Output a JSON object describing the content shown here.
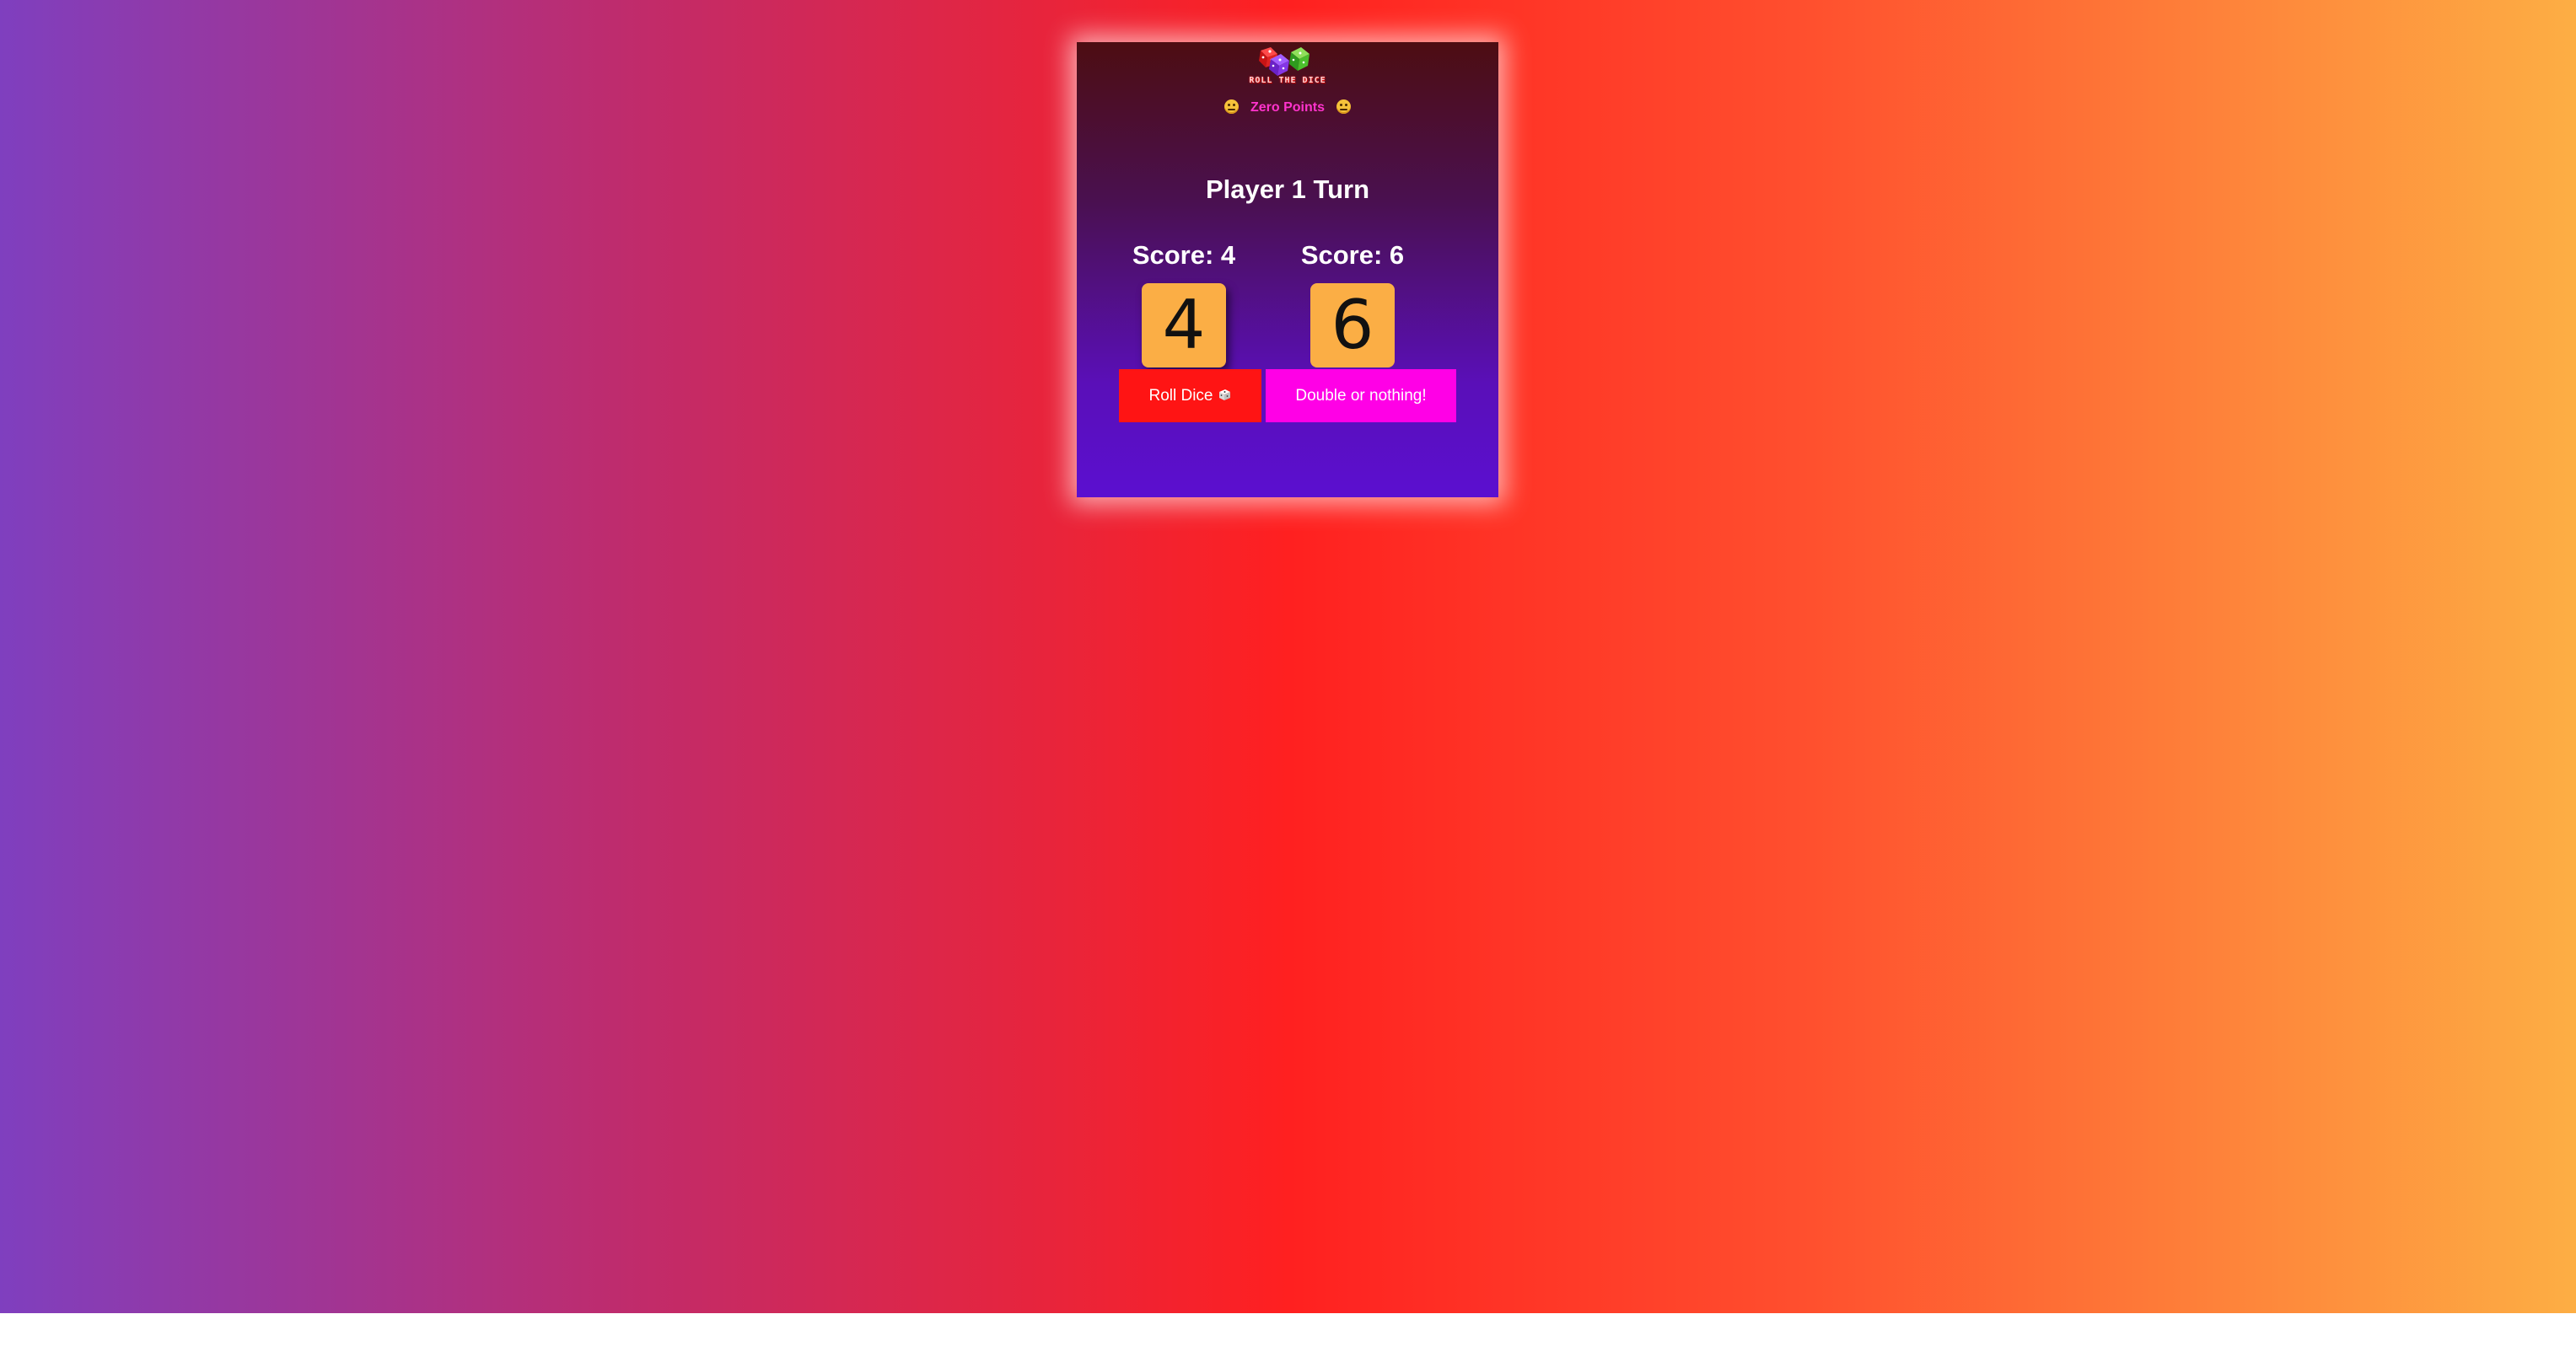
{
  "app": {
    "logo_text": "ROLL THE DICE",
    "status": {
      "text": "Zero Points",
      "left_icon": "unhappy-face-icon",
      "right_icon": "unhappy-face-icon"
    },
    "turn_title": "Player 1 Turn",
    "players": [
      {
        "score_label": "Score: 4",
        "die_value": "4",
        "active": true
      },
      {
        "score_label": "Score: 6",
        "die_value": "6",
        "active": false
      }
    ],
    "buttons": {
      "roll_label": "Roll Dice",
      "roll_icon": "dice-icon",
      "double_label": "Double or nothing!"
    },
    "colors": {
      "roll_button": "#ff1414",
      "double_button": "#ff00e6",
      "die_face": "#fbae45",
      "status_text": "#ff33cc"
    }
  }
}
